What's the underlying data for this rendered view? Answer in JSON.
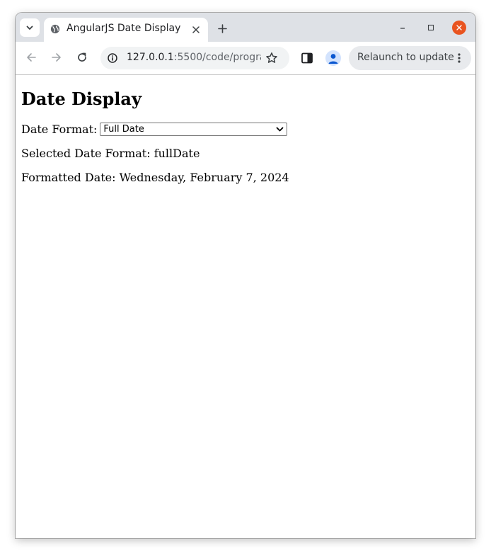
{
  "browser": {
    "tab_title": "AngularJS Date Display",
    "url_host": "127.0.0.1",
    "url_rest": ":5500/code/progra...",
    "relaunch_label": "Relaunch to update"
  },
  "page": {
    "title": "Date Display",
    "format_label": "Date Format:",
    "format_selected": "Full Date",
    "selected_prefix": "Selected Date Format: ",
    "selected_value": "fullDate",
    "formatted_prefix": "Formatted Date: ",
    "formatted_value": "Wednesday, February 7, 2024"
  },
  "colors": {
    "window_close": "#e95420",
    "tabstrip_bg": "#dee1e6",
    "omnibox_bg": "#f1f3f4",
    "relaunch_bg": "#e8eaed"
  },
  "icons": [
    "tab-search-icon",
    "globe-icon",
    "close-icon",
    "plus-icon",
    "minimize-icon",
    "maximize-icon",
    "window-close-icon",
    "back-arrow-icon",
    "forward-arrow-icon",
    "reload-icon",
    "info-icon",
    "star-icon",
    "side-panel-icon",
    "profile-icon",
    "more-vert-icon",
    "chevron-down-icon"
  ]
}
